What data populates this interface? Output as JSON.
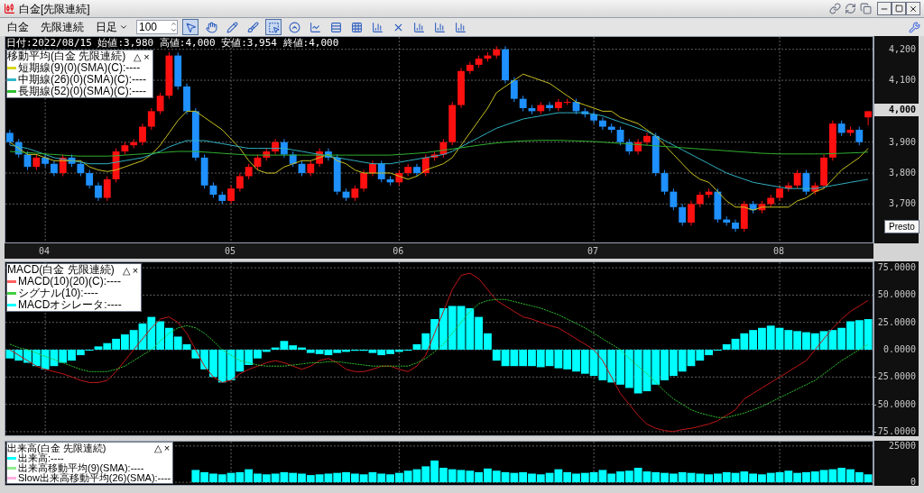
{
  "window": {
    "title": "白金[先限連続]"
  },
  "toolbar": {
    "items": [
      {
        "kind": "label",
        "text": "白金"
      },
      {
        "kind": "label",
        "text": "先限連続"
      },
      {
        "kind": "dropdown",
        "text": "日足"
      },
      {
        "kind": "spin",
        "text": "100"
      }
    ],
    "tools": [
      {
        "kind": "cursor",
        "selected": true
      },
      {
        "kind": "hand",
        "selected": false
      },
      {
        "kind": "pencil",
        "selected": false
      },
      {
        "kind": "brush",
        "selected": false
      },
      {
        "kind": "frame",
        "selected": true
      },
      {
        "kind": "circle",
        "selected": false
      },
      {
        "kind": "chart",
        "selected": false
      },
      {
        "kind": "rows",
        "selected": false
      },
      {
        "kind": "grid",
        "selected": false
      },
      {
        "kind": "bars",
        "selected": false
      },
      {
        "kind": "cross",
        "selected": false
      },
      {
        "kind": "bars",
        "selected": false
      },
      {
        "kind": "bars",
        "selected": false
      },
      {
        "kind": "bars",
        "selected": false
      }
    ]
  },
  "price_panel": {
    "info": "日付:2022/08/15 始値:3,980 高値:4,000 安値:3,954 終値:4,000",
    "legend": {
      "title": "移動平均(白金 先限連続)",
      "buttons": [
        "△",
        "×"
      ],
      "items": [
        {
          "text": "短期線(9)(0)(SMA)(C):----",
          "color": "#d8d820"
        },
        {
          "text": "中期線(26)(0)(SMA)(C):----",
          "color": "#30b8c8"
        },
        {
          "text": "長期線(52)(0)(SMA)(C):----",
          "color": "#30c030"
        }
      ]
    },
    "last_price": "4,000",
    "chart_data": {
      "type": "candlestick",
      "grid": true,
      "ylim": [
        3570,
        4240
      ],
      "categories": [
        null,
        null,
        null,
        null,
        "04",
        null,
        null,
        null,
        null,
        null,
        null,
        null,
        null,
        null,
        null,
        null,
        null,
        null,
        null,
        null,
        null,
        null,
        null,
        null,
        null,
        "05",
        null,
        null,
        null,
        null,
        null,
        null,
        null,
        null,
        null,
        null,
        null,
        null,
        null,
        null,
        null,
        null,
        null,
        null,
        "06",
        null,
        null,
        null,
        null,
        null,
        null,
        null,
        null,
        null,
        null,
        null,
        null,
        null,
        null,
        null,
        null,
        null,
        null,
        null,
        null,
        null,
        "07",
        null,
        null,
        null,
        null,
        null,
        null,
        null,
        null,
        null,
        null,
        null,
        null,
        null,
        null,
        null,
        null,
        null,
        null,
        null,
        null,
        "08",
        null,
        null,
        null,
        null,
        null,
        null,
        null,
        null,
        null,
        null
      ],
      "yticks": [
        {
          "value": 4200,
          "label": "4,200"
        },
        {
          "value": 4100,
          "label": "4,100"
        },
        {
          "value": 3900,
          "label": "3,900"
        },
        {
          "value": 3800,
          "label": "3,800"
        },
        {
          "value": 3700,
          "label": "3,700"
        }
      ],
      "ohlc": [
        [
          3930,
          3940,
          3890,
          3900
        ],
        [
          3900,
          3910,
          3850,
          3860
        ],
        [
          3860,
          3870,
          3810,
          3820
        ],
        [
          3820,
          3860,
          3810,
          3850
        ],
        [
          3850,
          3860,
          3820,
          3830
        ],
        [
          3830,
          3840,
          3790,
          3800
        ],
        [
          3800,
          3860,
          3790,
          3850
        ],
        [
          3850,
          3860,
          3820,
          3830
        ],
        [
          3830,
          3840,
          3790,
          3800
        ],
        [
          3800,
          3810,
          3750,
          3760
        ],
        [
          3760,
          3770,
          3710,
          3720
        ],
        [
          3720,
          3790,
          3710,
          3780
        ],
        [
          3780,
          3880,
          3770,
          3870
        ],
        [
          3870,
          3900,
          3860,
          3890
        ],
        [
          3890,
          3910,
          3880,
          3900
        ],
        [
          3900,
          3960,
          3890,
          3950
        ],
        [
          3950,
          4010,
          3940,
          4000
        ],
        [
          4000,
          4060,
          3990,
          4050
        ],
        [
          4050,
          4190,
          4040,
          4180
        ],
        [
          4180,
          4190,
          4070,
          4080
        ],
        [
          4080,
          4090,
          3990,
          4000
        ],
        [
          4000,
          4010,
          3840,
          3850
        ],
        [
          3850,
          3860,
          3750,
          3760
        ],
        [
          3760,
          3770,
          3720,
          3730
        ],
        [
          3730,
          3740,
          3700,
          3710
        ],
        [
          3710,
          3760,
          3700,
          3750
        ],
        [
          3750,
          3800,
          3740,
          3790
        ],
        [
          3790,
          3830,
          3780,
          3820
        ],
        [
          3820,
          3860,
          3810,
          3850
        ],
        [
          3850,
          3880,
          3840,
          3870
        ],
        [
          3870,
          3910,
          3860,
          3900
        ],
        [
          3900,
          3910,
          3850,
          3860
        ],
        [
          3860,
          3870,
          3820,
          3830
        ],
        [
          3830,
          3840,
          3790,
          3800
        ],
        [
          3800,
          3840,
          3790,
          3830
        ],
        [
          3830,
          3880,
          3820,
          3870
        ],
        [
          3870,
          3880,
          3840,
          3850
        ],
        [
          3850,
          3860,
          3730,
          3740
        ],
        [
          3740,
          3750,
          3710,
          3720
        ],
        [
          3720,
          3760,
          3710,
          3750
        ],
        [
          3750,
          3810,
          3740,
          3800
        ],
        [
          3800,
          3840,
          3790,
          3830
        ],
        [
          3830,
          3840,
          3770,
          3780
        ],
        [
          3780,
          3790,
          3760,
          3770
        ],
        [
          3770,
          3810,
          3760,
          3800
        ],
        [
          3800,
          3830,
          3790,
          3820
        ],
        [
          3820,
          3830,
          3790,
          3800
        ],
        [
          3800,
          3860,
          3790,
          3850
        ],
        [
          3850,
          3870,
          3840,
          3860
        ],
        [
          3860,
          3910,
          3850,
          3900
        ],
        [
          3900,
          4030,
          3890,
          4020
        ],
        [
          4020,
          4140,
          4010,
          4130
        ],
        [
          4130,
          4160,
          4120,
          4150
        ],
        [
          4150,
          4180,
          4140,
          4170
        ],
        [
          4170,
          4190,
          4160,
          4180
        ],
        [
          4180,
          4210,
          4170,
          4200
        ],
        [
          4200,
          4210,
          4090,
          4100
        ],
        [
          4100,
          4110,
          4030,
          4040
        ],
        [
          4040,
          4050,
          4000,
          4010
        ],
        [
          4010,
          4020,
          3990,
          4000
        ],
        [
          4000,
          4030,
          3990,
          4020
        ],
        [
          4020,
          4030,
          4000,
          4010
        ],
        [
          4010,
          4040,
          4000,
          4030
        ],
        [
          4030,
          4040,
          4020,
          4030
        ],
        [
          4030,
          4040,
          3990,
          4000
        ],
        [
          4000,
          4010,
          3980,
          3990
        ],
        [
          3990,
          4000,
          3960,
          3970
        ],
        [
          3970,
          3980,
          3940,
          3950
        ],
        [
          3950,
          3960,
          3930,
          3940
        ],
        [
          3940,
          3950,
          3890,
          3900
        ],
        [
          3900,
          3910,
          3860,
          3870
        ],
        [
          3870,
          3910,
          3860,
          3900
        ],
        [
          3900,
          3930,
          3890,
          3920
        ],
        [
          3920,
          3930,
          3790,
          3800
        ],
        [
          3800,
          3810,
          3730,
          3740
        ],
        [
          3740,
          3750,
          3680,
          3690
        ],
        [
          3690,
          3700,
          3630,
          3640
        ],
        [
          3640,
          3710,
          3630,
          3700
        ],
        [
          3700,
          3740,
          3690,
          3730
        ],
        [
          3730,
          3750,
          3720,
          3740
        ],
        [
          3740,
          3750,
          3640,
          3650
        ],
        [
          3650,
          3660,
          3630,
          3640
        ],
        [
          3640,
          3650,
          3610,
          3620
        ],
        [
          3620,
          3710,
          3610,
          3700
        ],
        [
          3700,
          3710,
          3670,
          3680
        ],
        [
          3680,
          3710,
          3670,
          3700
        ],
        [
          3700,
          3730,
          3690,
          3720
        ],
        [
          3720,
          3760,
          3710,
          3750
        ],
        [
          3750,
          3770,
          3740,
          3760
        ],
        [
          3760,
          3810,
          3750,
          3800
        ],
        [
          3800,
          3810,
          3730,
          3740
        ],
        [
          3740,
          3770,
          3730,
          3760
        ],
        [
          3760,
          3860,
          3750,
          3850
        ],
        [
          3850,
          3970,
          3840,
          3960
        ],
        [
          3960,
          3970,
          3920,
          3930
        ],
        [
          3930,
          3950,
          3920,
          3940
        ],
        [
          3940,
          3950,
          3890,
          3900
        ],
        [
          3980,
          4000,
          3954,
          4000
        ]
      ],
      "series": [
        {
          "type": "line",
          "color": "#c8c020",
          "values": [
            3900,
            3880,
            3860,
            3860,
            3850,
            3840,
            3840,
            3840,
            3840,
            3820,
            3810,
            3805,
            3810,
            3820,
            3830,
            3840,
            3860,
            3890,
            3930,
            3970,
            4000,
            4000,
            3980,
            3960,
            3940,
            3910,
            3880,
            3840,
            3810,
            3800,
            3800,
            3820,
            3830,
            3840,
            3840,
            3850,
            3860,
            3840,
            3830,
            3810,
            3800,
            3800,
            3800,
            3800,
            3790,
            3780,
            3790,
            3810,
            3820,
            3830,
            3850,
            3890,
            3930,
            3970,
            4010,
            4060,
            4080,
            4100,
            4120,
            4110,
            4100,
            4090,
            4070,
            4050,
            4030,
            4020,
            4010,
            4000,
            4000,
            3980,
            3970,
            3960,
            3940,
            3920,
            3890,
            3860,
            3830,
            3800,
            3780,
            3770,
            3740,
            3710,
            3690,
            3690,
            3680,
            3690,
            3690,
            3690,
            3690,
            3710,
            3720,
            3740,
            3750,
            3780,
            3810,
            3830,
            3850,
            3880
          ]
        },
        {
          "type": "line",
          "color": "#30b0c0",
          "values": [
            3890,
            3885,
            3880,
            3870,
            3860,
            3850,
            3845,
            3840,
            3835,
            3830,
            3830,
            3830,
            3835,
            3840,
            3845,
            3850,
            3860,
            3870,
            3885,
            3895,
            3905,
            3905,
            3905,
            3900,
            3895,
            3890,
            3885,
            3880,
            3880,
            3880,
            3880,
            3880,
            3875,
            3870,
            3865,
            3860,
            3855,
            3850,
            3845,
            3840,
            3835,
            3830,
            3830,
            3830,
            3835,
            3840,
            3845,
            3850,
            3855,
            3860,
            3870,
            3885,
            3900,
            3915,
            3930,
            3945,
            3955,
            3965,
            3975,
            3980,
            3985,
            3990,
            3995,
            3995,
            3995,
            3995,
            3990,
            3985,
            3975,
            3965,
            3955,
            3945,
            3935,
            3920,
            3905,
            3890,
            3875,
            3860,
            3845,
            3830,
            3815,
            3800,
            3790,
            3780,
            3770,
            3765,
            3760,
            3755,
            3750,
            3750,
            3750,
            3750,
            3755,
            3760,
            3765,
            3770,
            3775,
            3780
          ]
        },
        {
          "type": "line",
          "color": "#30b030",
          "values": [
            3870,
            3868,
            3866,
            3864,
            3862,
            3860,
            3858,
            3856,
            3855,
            3855,
            3855,
            3855,
            3856,
            3858,
            3860,
            3862,
            3864,
            3866,
            3868,
            3870,
            3870,
            3870,
            3868,
            3866,
            3864,
            3862,
            3860,
            3858,
            3858,
            3858,
            3858,
            3858,
            3858,
            3858,
            3858,
            3858,
            3858,
            3858,
            3858,
            3858,
            3858,
            3858,
            3858,
            3858,
            3860,
            3862,
            3864,
            3866,
            3870,
            3874,
            3878,
            3882,
            3886,
            3890,
            3894,
            3897,
            3900,
            3902,
            3904,
            3905,
            3906,
            3906,
            3906,
            3905,
            3904,
            3903,
            3902,
            3900,
            3898,
            3896,
            3894,
            3892,
            3890,
            3888,
            3886,
            3884,
            3882,
            3880,
            3878,
            3876,
            3874,
            3872,
            3870,
            3868,
            3866,
            3864,
            3863,
            3862,
            3862,
            3862,
            3862,
            3862,
            3862,
            3863,
            3864,
            3865,
            3866,
            3868
          ]
        }
      ]
    }
  },
  "macd_panel": {
    "legend": {
      "title": "MACD(白金 先限連続)",
      "buttons": [
        "△",
        "×"
      ],
      "items": [
        {
          "text": "MACD(10)(20)(C):----",
          "color": "#ff6060"
        },
        {
          "text": "シグナル(10):----",
          "color": "#40d040"
        },
        {
          "text": "MACDオシレータ:----",
          "color": "#00ffff"
        }
      ]
    },
    "chart_data": {
      "type": "bar",
      "grid": true,
      "ylim": [
        -80,
        80
      ],
      "yticks": [
        {
          "value": 75,
          "label": "75.0000"
        },
        {
          "value": 50,
          "label": "50.0000"
        },
        {
          "value": 25,
          "label": "25.0000"
        },
        {
          "value": 0,
          "label": "0.0000"
        },
        {
          "value": -25,
          "label": "-25.0000"
        },
        {
          "value": -50,
          "label": "-50.0000"
        },
        {
          "value": -75,
          "label": "-75.0000"
        }
      ],
      "series": [
        {
          "color": "#00ffff",
          "values": [
            -8,
            -10,
            -12,
            -15,
            -18,
            -15,
            -12,
            -10,
            -5,
            0,
            3,
            6,
            10,
            14,
            18,
            24,
            30,
            26,
            20,
            12,
            5,
            -8,
            -18,
            -25,
            -30,
            -28,
            -20,
            -14,
            -8,
            -2,
            2,
            8,
            4,
            2,
            -3,
            -4,
            -5,
            -3,
            -2,
            -1,
            -1,
            -3,
            -5,
            -4,
            -2,
            0,
            5,
            15,
            28,
            38,
            40,
            40,
            38,
            30,
            15,
            -10,
            -15,
            -15,
            -15,
            -15,
            -16,
            -15,
            -17,
            -18,
            -20,
            -22,
            -24,
            -28,
            -30,
            -32,
            -35,
            -40,
            -38,
            -32,
            -28,
            -24,
            -20,
            -15,
            -10,
            -5,
            0,
            5,
            10,
            15,
            18,
            20,
            22,
            20,
            18,
            17,
            16,
            15,
            17,
            18,
            20,
            26,
            27,
            28
          ]
        },
        {
          "type": "line",
          "color": "#c01818",
          "values": [
            0,
            -5,
            -10,
            -15,
            -18,
            -20,
            -22,
            -25,
            -28,
            -30,
            -30,
            -28,
            -20,
            -10,
            0,
            10,
            20,
            28,
            30,
            25,
            15,
            0,
            -15,
            -25,
            -30,
            -28,
            -22,
            -18,
            -15,
            -12,
            -10,
            -12,
            -15,
            -18,
            -15,
            -10,
            -8,
            -12,
            -18,
            -20,
            -20,
            -18,
            -15,
            -15,
            -18,
            -20,
            -15,
            -5,
            15,
            35,
            55,
            68,
            70,
            65,
            55,
            45,
            40,
            35,
            30,
            28,
            25,
            22,
            20,
            15,
            10,
            5,
            0,
            -10,
            -25,
            -40,
            -50,
            -60,
            -68,
            -72,
            -74,
            -75,
            -73,
            -72,
            -70,
            -68,
            -65,
            -60,
            -55,
            -45,
            -40,
            -35,
            -30,
            -25,
            -20,
            -15,
            -10,
            0,
            10,
            20,
            28,
            35,
            40,
            45
          ]
        },
        {
          "type": "line",
          "line_style": "dashed",
          "color": "#30c030",
          "values": [
            5,
            2,
            0,
            -3,
            -6,
            -9,
            -12,
            -15,
            -18,
            -20,
            -20,
            -20,
            -18,
            -15,
            -10,
            -5,
            0,
            8,
            15,
            20,
            22,
            20,
            15,
            8,
            0,
            -5,
            -10,
            -12,
            -14,
            -15,
            -15,
            -15,
            -14,
            -13,
            -12,
            -12,
            -11,
            -11,
            -12,
            -13,
            -14,
            -15,
            -15,
            -15,
            -15,
            -15,
            -12,
            -8,
            -2,
            5,
            15,
            25,
            35,
            42,
            45,
            46,
            46,
            44,
            42,
            40,
            38,
            35,
            32,
            28,
            24,
            20,
            15,
            10,
            5,
            0,
            -8,
            -15,
            -22,
            -30,
            -38,
            -45,
            -50,
            -55,
            -58,
            -60,
            -62,
            -62,
            -60,
            -58,
            -55,
            -52,
            -48,
            -44,
            -40,
            -36,
            -32,
            -28,
            -22,
            -16,
            -10,
            -5,
            0,
            5
          ]
        }
      ]
    }
  },
  "volume_panel": {
    "legend": {
      "title": "出来高(白金 先限連続)",
      "buttons": [
        "△",
        "×"
      ],
      "items": [
        {
          "text": "出来高:----",
          "color": "#00ffff"
        },
        {
          "text": "出来高移動平均(9)(SMA):----",
          "color": "#90ee90"
        },
        {
          "text": "Slow出来高移動平均(26)(SMA):----",
          "color": "#ffb0e0"
        }
      ]
    },
    "chart_data": {
      "type": "bar",
      "grid": true,
      "ylim": [
        -3000,
        28000
      ],
      "yticks": [
        {
          "value": 25000,
          "label": "25000"
        },
        {
          "value": 0,
          "label": "0"
        }
      ],
      "series": [
        {
          "color": "#00ffff",
          "values": [
            null,
            null,
            null,
            null,
            null,
            null,
            null,
            null,
            null,
            null,
            null,
            null,
            null,
            null,
            null,
            null,
            null,
            null,
            null,
            null,
            null,
            8500,
            7000,
            6000,
            5500,
            6500,
            7000,
            9000,
            6000,
            5500,
            6000,
            7000,
            6500,
            6000,
            5000,
            5500,
            6000,
            6500,
            7000,
            6000,
            5500,
            7000,
            6000,
            5500,
            6500,
            8000,
            9000,
            11000,
            15000,
            10000,
            9000,
            8500,
            8000,
            7000,
            9500,
            8000,
            7000,
            6500,
            7000,
            6000,
            5500,
            6500,
            9000,
            7000,
            6000,
            6500,
            7000,
            8500,
            6000,
            7500,
            8000,
            10000,
            7500,
            7000,
            6500,
            6000,
            7000,
            6500,
            6000,
            5500,
            6000,
            7000,
            6500,
            7500,
            6000,
            5500,
            6500,
            7000,
            8000,
            6500,
            7000,
            7500,
            8500,
            9000,
            10000,
            9000,
            7000,
            5500
          ]
        }
      ]
    }
  },
  "tooltip": "Presto"
}
